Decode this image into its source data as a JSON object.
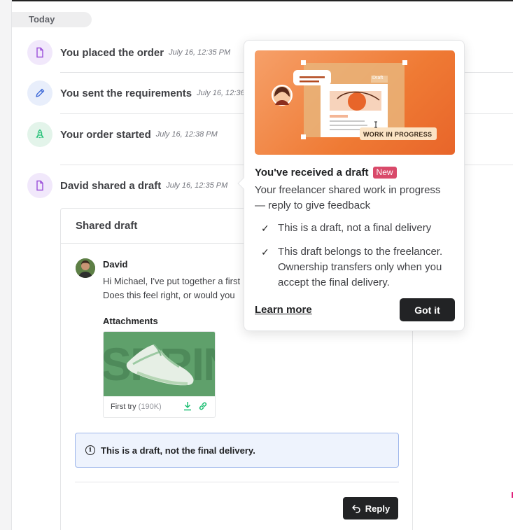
{
  "timeline": {
    "section_label": "Today",
    "events": [
      {
        "title": "You placed the order",
        "time": "July 16, 12:35 PM",
        "icon": "document-icon"
      },
      {
        "title": "You sent the requirements",
        "time": "July 16, 12:36",
        "icon": "pencil-icon"
      },
      {
        "title": "Your order started",
        "time": "July 16, 12:38 PM",
        "icon": "rocket-icon"
      },
      {
        "title": "David shared a draft",
        "time": "July 16, 12:35 PM",
        "icon": "document-icon"
      }
    ]
  },
  "draft_card": {
    "header": "Shared draft",
    "author": "David",
    "message_line1": "Hi Michael, I've put together a first",
    "message_line2": "Does this feel right, or would you",
    "attachments_label": "Attachments",
    "attachment": {
      "name": "First try",
      "size": "(190K)",
      "thumb_text": "SPRINT"
    },
    "notice": "This is a draft, not the final delivery.",
    "reply_label": "Reply"
  },
  "popover": {
    "illustration_tag": "Draft",
    "illustration_badge": "WORK IN PROGRESS",
    "title": "You've received a draft",
    "badge": "New",
    "description": "Your freelancer shared work in progress — reply to give feedback",
    "items": [
      "This is a draft, not a final delivery",
      "This draft belongs to the freelancer. Ownership transfers only when you accept the final delivery."
    ],
    "learn_more": "Learn more",
    "confirm": "Got it"
  },
  "colors": {
    "purple_icon_bg": "#f1e8fb",
    "blue_icon_bg": "#e8eefb",
    "green_icon_bg": "#e3f4ea",
    "new_badge": "#d94a6a",
    "illustration_orange": "#ef7a34"
  }
}
